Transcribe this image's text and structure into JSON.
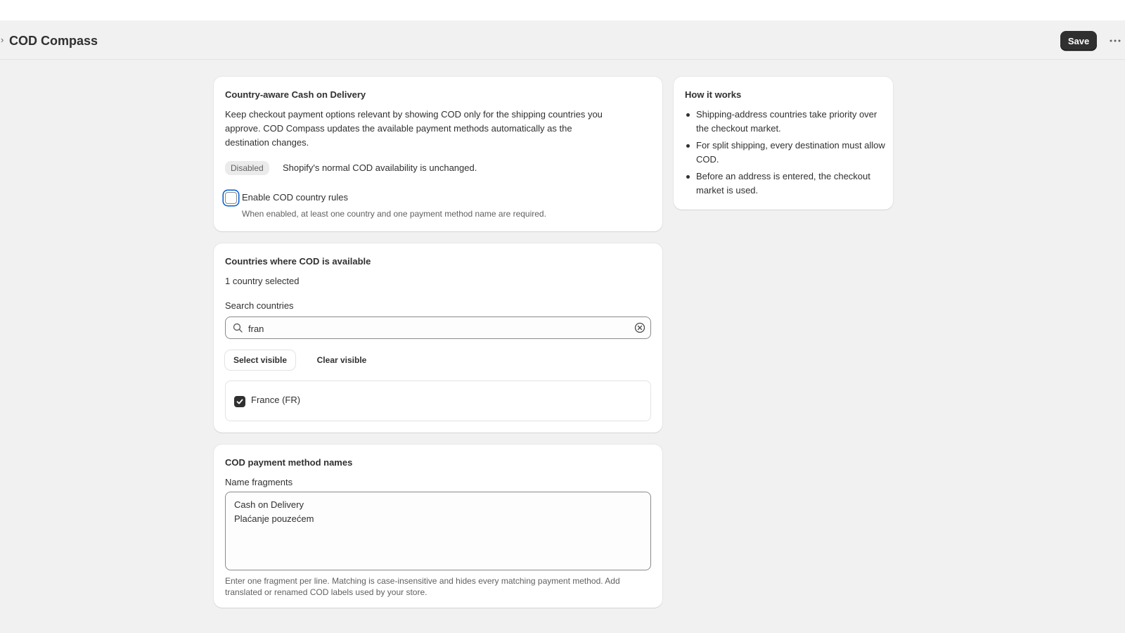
{
  "header": {
    "breadcrumb_chevron": "›",
    "title": "COD Compass",
    "save_label": "Save"
  },
  "cod_card": {
    "title": "Country-aware Cash on Delivery",
    "description": "Keep checkout payment options relevant by showing COD only for the shipping countries you approve. COD Compass updates the available payment methods automatically as the destination changes.",
    "status_badge": "Disabled",
    "status_text": "Shopify's normal COD availability is unchanged.",
    "enable_label": "Enable COD country rules",
    "enable_checked": false,
    "enable_help": "When enabled, at least one country and one payment method name are required."
  },
  "countries_card": {
    "title": "Countries where COD is available",
    "selected_count": "1 country selected",
    "search_label": "Search countries",
    "search_value": "fran",
    "select_visible_label": "Select visible",
    "clear_visible_label": "Clear visible",
    "countries": [
      {
        "label": "France (FR)",
        "checked": true
      }
    ]
  },
  "names_card": {
    "title": "COD payment method names",
    "field_label": "Name fragments",
    "fragments": "Cash on Delivery\nPlaćanje pouzećem",
    "help": "Enter one fragment per line. Matching is case-insensitive and hides every matching payment method. Add translated or renamed COD labels used by your store."
  },
  "how_card": {
    "title": "How it works",
    "items": [
      "Shipping-address countries take priority over the checkout market.",
      "For split shipping, every destination must allow COD.",
      "Before an address is entered, the checkout market is used."
    ]
  },
  "colors": {
    "primary_button": "#303030",
    "focus_ring": "#005bd3",
    "background": "#f1f1f1"
  }
}
